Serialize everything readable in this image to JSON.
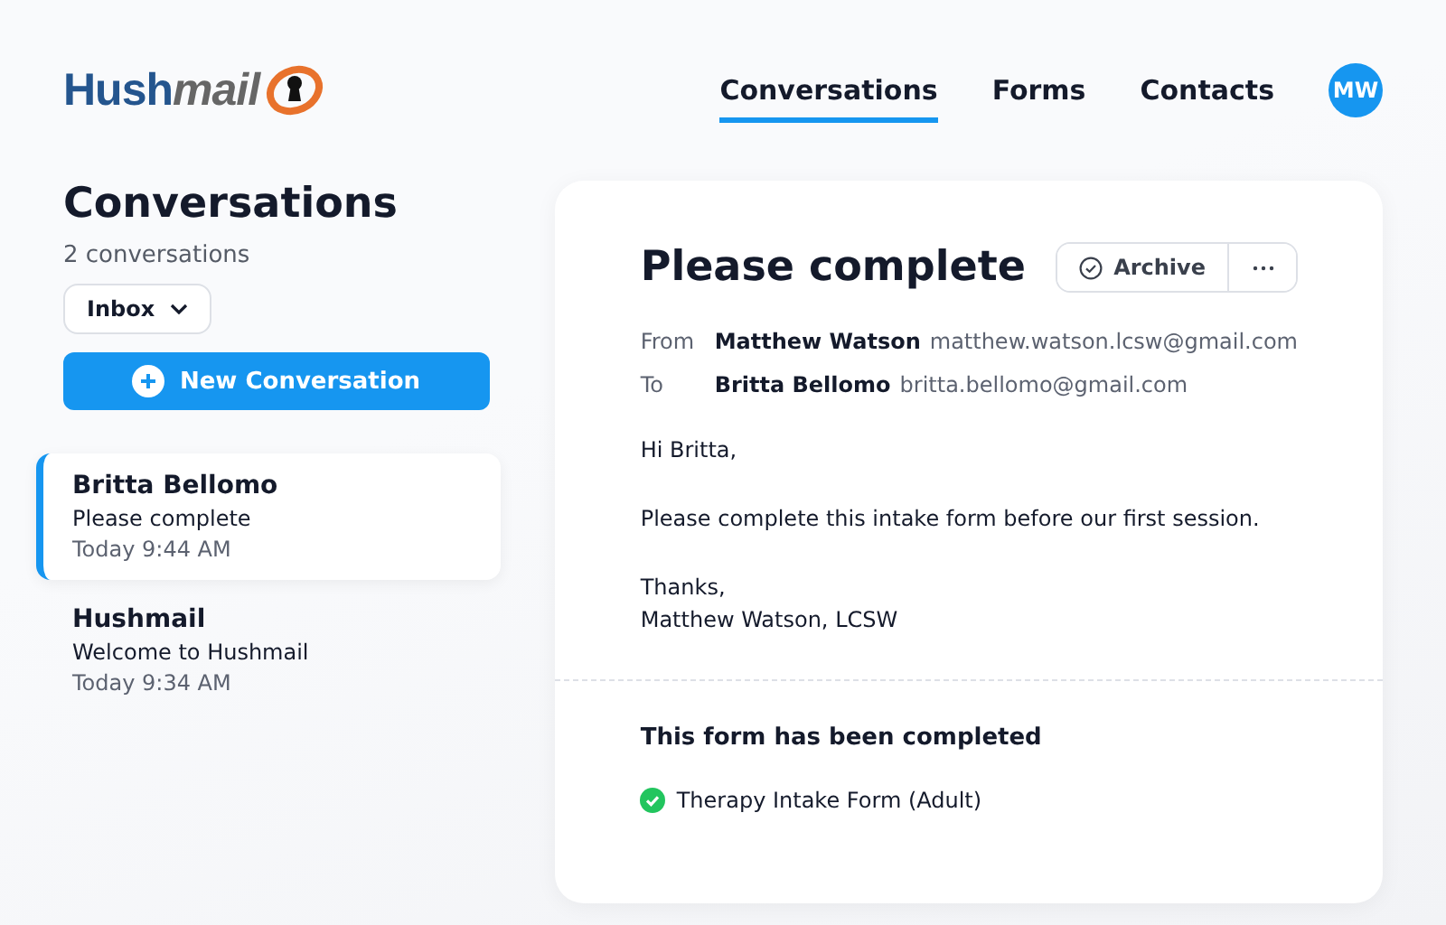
{
  "logo": {
    "first": "Hush",
    "second": "mail"
  },
  "nav": [
    {
      "label": "Conversations",
      "selected": true
    },
    {
      "label": "Forms",
      "selected": false
    },
    {
      "label": "Contacts",
      "selected": false
    }
  ],
  "avatar": {
    "initials": "MW"
  },
  "sidebar": {
    "title": "Conversations",
    "count": "2 conversations",
    "folder": "Inbox",
    "new_button": "New Conversation",
    "items": [
      {
        "name": "Britta Bellomo",
        "subject": "Please complete",
        "time": "Today 9:44 AM",
        "selected": true
      },
      {
        "name": "Hushmail",
        "subject": "Welcome to Hushmail",
        "time": "Today 9:34 AM",
        "selected": false
      }
    ]
  },
  "message": {
    "subject": "Please complete",
    "archive": "Archive",
    "headers": [
      {
        "label": "From",
        "name": "Matthew Watson",
        "email": "matthew.watson.lcsw@gmail.com"
      },
      {
        "label": "To",
        "name": "Britta Bellomo",
        "email": "britta.bellomo@gmail.com"
      }
    ],
    "body": [
      "Hi Britta,",
      "Please complete this intake form before our first session."
    ],
    "signoff": [
      "Thanks,",
      "Matthew Watson, LCSW"
    ],
    "form_status": "This form has been completed",
    "forms": [
      {
        "name": "Therapy Intake Form (Adult)",
        "completed": true
      }
    ]
  }
}
